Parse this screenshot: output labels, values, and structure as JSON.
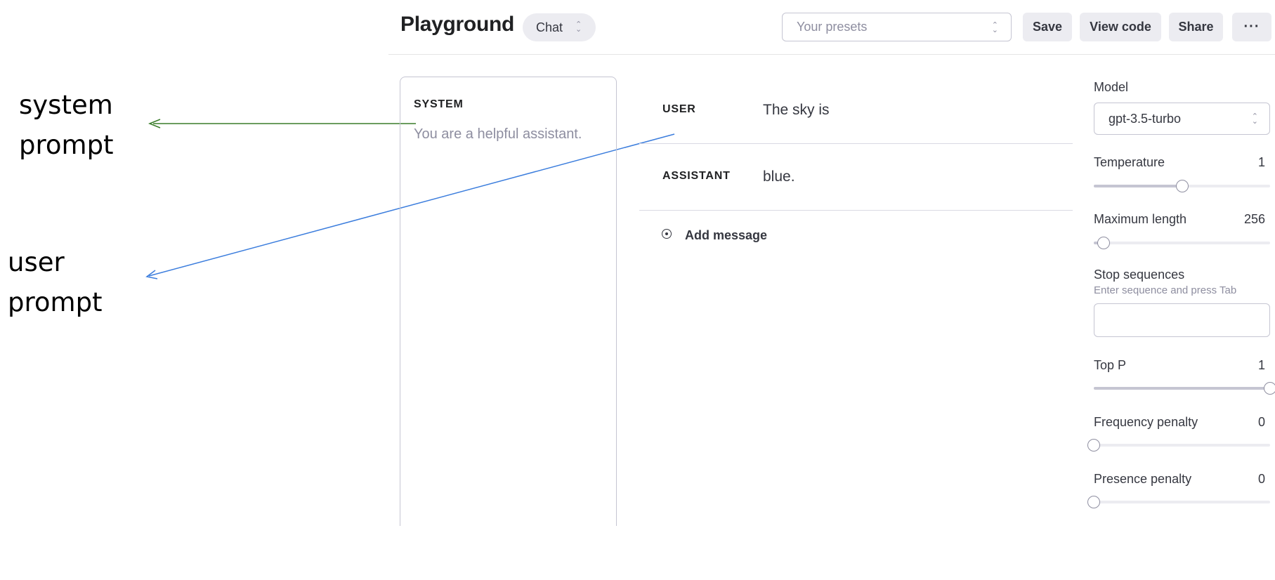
{
  "annotations": {
    "system_prompt": "system\nprompt",
    "user_prompt": "user\nprompt",
    "system_arrow_color": "#3a7d2a",
    "user_arrow_color": "#3b7ddd"
  },
  "header": {
    "title": "Playground",
    "mode": "Chat",
    "presets_placeholder": "Your presets",
    "save_label": "Save",
    "view_code_label": "View code",
    "share_label": "Share",
    "more_label": "···"
  },
  "system": {
    "label": "SYSTEM",
    "placeholder": "You are a helpful assistant."
  },
  "messages": [
    {
      "role": "USER",
      "content": "The sky is"
    },
    {
      "role": "ASSISTANT",
      "content": "blue."
    }
  ],
  "add_message_label": "Add message",
  "settings": {
    "model_label": "Model",
    "model_value": "gpt-3.5-turbo",
    "temperature": {
      "label": "Temperature",
      "value": "1",
      "fraction": 0.5
    },
    "max_length": {
      "label": "Maximum length",
      "value": "256",
      "fraction": 0.055
    },
    "stop_sequences": {
      "label": "Stop sequences",
      "hint": "Enter sequence and press Tab"
    },
    "top_p": {
      "label": "Top P",
      "value": "1",
      "fraction": 1.0
    },
    "frequency_penalty": {
      "label": "Frequency penalty",
      "value": "0",
      "fraction": 0.0
    },
    "presence_penalty": {
      "label": "Presence penalty",
      "value": "0",
      "fraction": 0.0
    }
  }
}
